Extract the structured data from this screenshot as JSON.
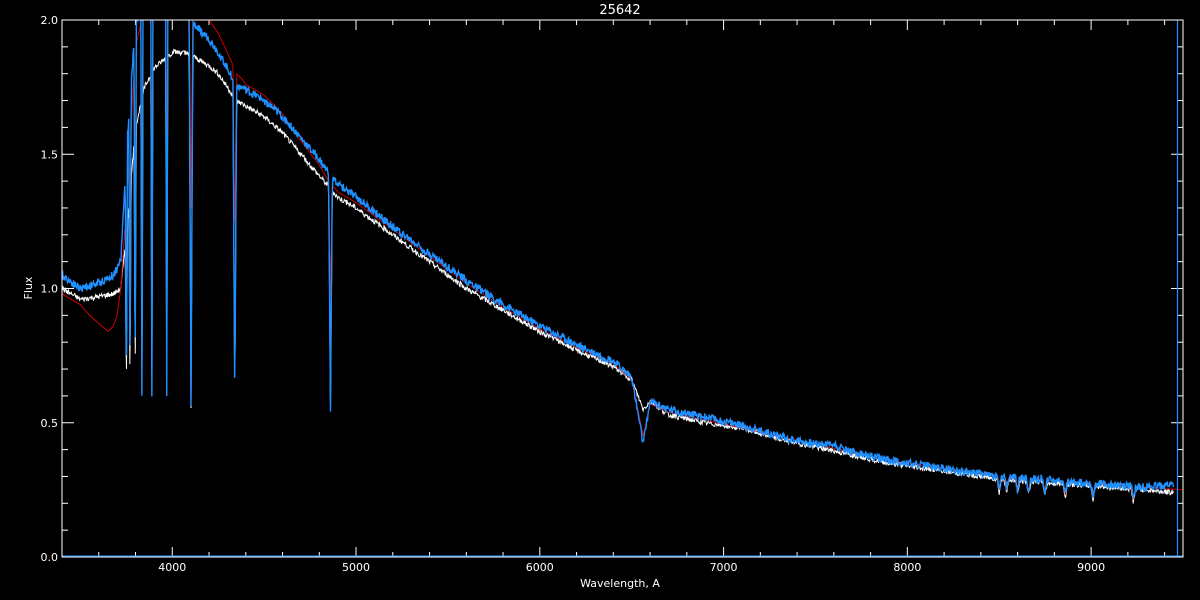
{
  "chart_data": {
    "type": "line",
    "title": "25642",
    "xlabel": "Wavelength, A",
    "ylabel": "Flux",
    "xlim": [
      3400,
      9500
    ],
    "ylim": [
      0.0,
      2.0
    ],
    "x_ticks": [
      4000,
      5000,
      6000,
      7000,
      8000,
      9000
    ],
    "y_ticks": [
      0.0,
      0.5,
      1.0,
      1.5,
      2.0
    ],
    "x_tick_labels": [
      "4000",
      "5000",
      "6000",
      "7000",
      "8000",
      "9000"
    ],
    "y_tick_labels": [
      "0.0",
      "0.5",
      "1.0",
      "1.5",
      "2.0"
    ],
    "colors": {
      "background": "#000000",
      "axes": "#ffffff",
      "observed": "#ffffff",
      "model": "#cc0000",
      "fit": "#1e90ff",
      "vertical_marker": "#1e90ff"
    },
    "vertical_marker_x": 9470,
    "series": [
      {
        "key": "observed",
        "x": [
          3400,
          3500,
          3600,
          3680,
          3720,
          3750,
          3800,
          3850,
          3900,
          3950,
          4000,
          4050,
          4100,
          4150,
          4200,
          4250,
          4300,
          4350,
          4400,
          4450,
          4500,
          4600,
          4700,
          4800,
          4850,
          4900,
          5000,
          5200,
          5400,
          5600,
          5800,
          6000,
          6200,
          6400,
          6500,
          6563,
          6600,
          6700,
          6900,
          7100,
          7300,
          7500,
          7700,
          7900,
          8100,
          8300,
          8500,
          8700,
          8900,
          9100,
          9300,
          9450
        ],
        "y": [
          1.0,
          0.96,
          0.97,
          0.98,
          1.0,
          1.2,
          1.6,
          1.75,
          1.82,
          1.85,
          1.88,
          1.88,
          1.87,
          1.85,
          1.83,
          1.8,
          1.75,
          1.7,
          1.68,
          1.66,
          1.64,
          1.58,
          1.5,
          1.42,
          1.38,
          1.34,
          1.3,
          1.2,
          1.1,
          1.0,
          0.92,
          0.84,
          0.77,
          0.71,
          0.66,
          0.55,
          0.58,
          0.53,
          0.5,
          0.48,
          0.44,
          0.41,
          0.38,
          0.35,
          0.33,
          0.31,
          0.29,
          0.28,
          0.27,
          0.26,
          0.25,
          0.24
        ]
      },
      {
        "key": "model",
        "x": [
          3400,
          3450,
          3500,
          3550,
          3600,
          3650,
          3680,
          3700,
          3720,
          3750,
          3800,
          3850,
          3900,
          3950,
          4000,
          4050,
          4100,
          4150,
          4200,
          4250,
          4300,
          4350,
          4380,
          4400,
          4450,
          4500,
          4600,
          4700,
          4800,
          4850,
          4900,
          5000,
          5200,
          5400,
          5600,
          5800,
          6000,
          6200,
          6400,
          6500,
          6563,
          6600,
          6700,
          6900,
          7100,
          7300,
          7500,
          7700,
          7900,
          8100,
          8300,
          8500,
          8700,
          8900,
          9100,
          9300,
          9500
        ],
        "y": [
          0.98,
          0.96,
          0.94,
          0.9,
          0.87,
          0.84,
          0.86,
          0.9,
          1.0,
          1.3,
          1.9,
          2.05,
          2.1,
          2.15,
          2.15,
          2.1,
          2.05,
          2.02,
          2.0,
          1.95,
          1.88,
          1.8,
          1.78,
          1.76,
          1.74,
          1.72,
          1.65,
          1.55,
          1.46,
          1.4,
          1.36,
          1.32,
          1.22,
          1.12,
          1.02,
          0.93,
          0.85,
          0.78,
          0.72,
          0.66,
          0.45,
          0.57,
          0.54,
          0.51,
          0.48,
          0.45,
          0.42,
          0.39,
          0.36,
          0.34,
          0.32,
          0.3,
          0.29,
          0.28,
          0.27,
          0.26,
          0.25
        ]
      },
      {
        "key": "fit",
        "x": [
          3400,
          3500,
          3600,
          3680,
          3720,
          3750,
          3800,
          3850,
          3900,
          3950,
          4000,
          4050,
          4100,
          4150,
          4200,
          4250,
          4300,
          4350,
          4400,
          4450,
          4500,
          4600,
          4700,
          4800,
          4850,
          4900,
          5000,
          5200,
          5400,
          5600,
          5800,
          6000,
          6200,
          6400,
          6500,
          6563,
          6600,
          6700,
          6900,
          7100,
          7300,
          7500,
          7600,
          7700,
          7900,
          8100,
          8300,
          8500,
          8700,
          8900,
          9100,
          9300,
          9450
        ],
        "y": [
          1.05,
          1.0,
          1.02,
          1.05,
          1.1,
          1.5,
          2.0,
          2.05,
          2.1,
          2.12,
          2.1,
          2.05,
          2.0,
          1.96,
          1.93,
          1.88,
          1.82,
          1.76,
          1.74,
          1.72,
          1.7,
          1.64,
          1.56,
          1.48,
          1.43,
          1.39,
          1.34,
          1.23,
          1.13,
          1.03,
          0.94,
          0.86,
          0.79,
          0.73,
          0.67,
          0.42,
          0.58,
          0.55,
          0.52,
          0.49,
          0.45,
          0.42,
          0.42,
          0.39,
          0.36,
          0.34,
          0.32,
          0.3,
          0.29,
          0.28,
          0.27,
          0.26,
          0.27
        ]
      }
    ],
    "absorption_lines": [
      3750,
      3770,
      3798,
      3835,
      3889,
      3970,
      4102,
      4340,
      4861,
      6563
    ],
    "telluric_band": [
      8500,
      8540,
      8600,
      8660,
      8750,
      8860,
      9010,
      9230
    ],
    "zero_line_y": 0.0
  }
}
